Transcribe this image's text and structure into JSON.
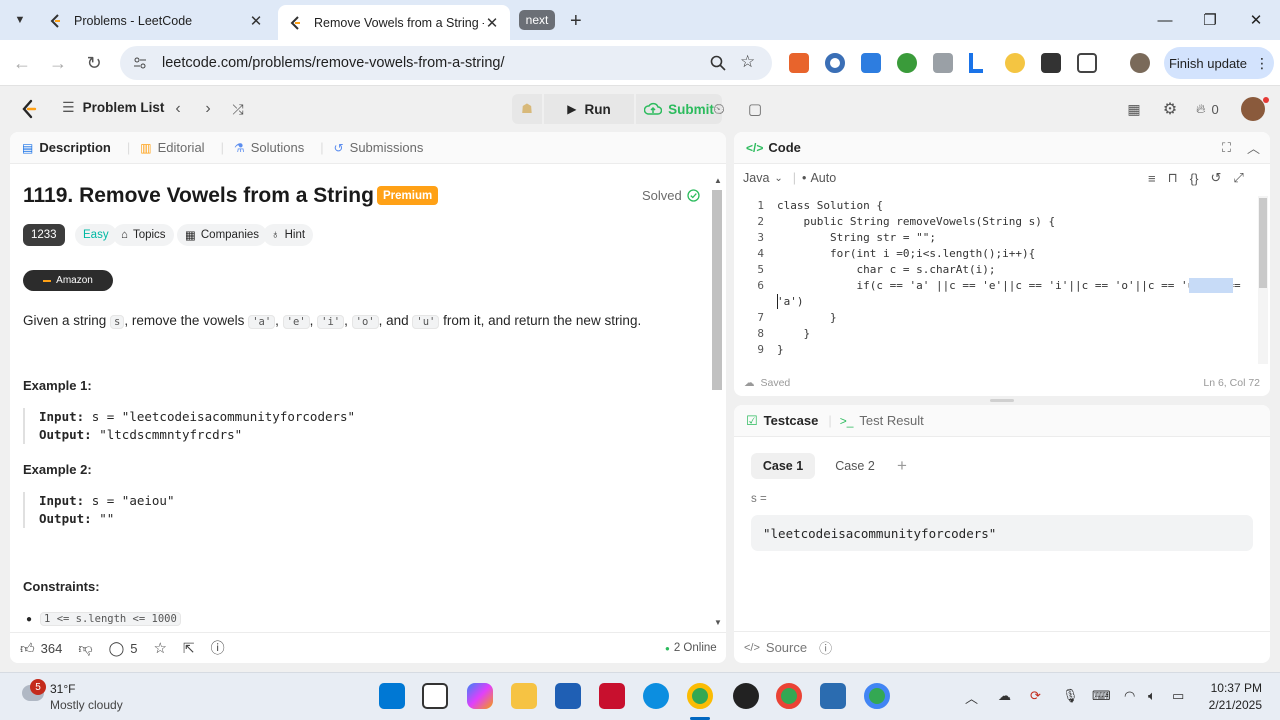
{
  "browser": {
    "tabs": [
      {
        "title": "Problems - LeetCode",
        "active": false
      },
      {
        "title": "Remove Vowels from a String -",
        "active": true
      }
    ],
    "group_chip": "next",
    "url": "leetcode.com/problems/remove-vowels-from-a-string/",
    "finish_update": "Finish update"
  },
  "app": {
    "nav": {
      "problem_list": "Problem List"
    },
    "run_label": "Run",
    "submit_label": "Submit",
    "streak_count": "0",
    "colors": {
      "accent": "#ffa116",
      "success": "#2cbb5d",
      "easy": "#00b8a3"
    }
  },
  "description": {
    "tabs": [
      "Description",
      "Editorial",
      "Solutions",
      "Submissions"
    ],
    "title": "1119. Remove Vowels from a String",
    "premium": "Premium",
    "solved": "Solved",
    "tags": {
      "number": "1233",
      "difficulty": "Easy",
      "topics": "Topics",
      "companies": "Companies",
      "hint": "Hint"
    },
    "company": "Amazon",
    "statement": {
      "p1": "Given a string ",
      "s": "s",
      "p2": ", remove the vowels ",
      "vowels": [
        "'a'",
        "'e'",
        "'i'",
        "'o'",
        "'u'"
      ],
      "sep": ", ",
      "and": ", and ",
      "p3": " from it, and return the new string."
    },
    "examples": [
      {
        "title": "Example 1:",
        "input_label": "Input:",
        "input": "s = \"leetcodeisacommunityforcoders\"",
        "output_label": "Output:",
        "output": "\"ltcdscmmntyfrcdrs\""
      },
      {
        "title": "Example 2:",
        "input_label": "Input:",
        "input": "s = \"aeiou\"",
        "output_label": "Output:",
        "output": "\"\""
      }
    ],
    "constraints_title": "Constraints:",
    "constraint_1": "1 <= s.length <= 1000",
    "footer": {
      "likes": "364",
      "comments": "5",
      "online": "2 Online"
    }
  },
  "code": {
    "title": "Code",
    "language": "Java",
    "mode": "Auto",
    "lines": [
      "class Solution {",
      "    public String removeVowels(String s) {",
      "        String str = \"\";",
      "        for(int i =0;i<s.length();i++){",
      "            char c = s.charAt(i);",
      "            if(c == 'a' ||c == 'e'||c == 'i'||c == 'o'||c == 'u'||c ==",
      "'a')",
      "        }",
      "    }",
      "}"
    ],
    "line_numbers": [
      "1",
      "2",
      "3",
      "4",
      "5",
      "6",
      "7",
      "8",
      "9"
    ],
    "saved": "Saved",
    "cursor": "Ln 6, Col 72"
  },
  "testcase": {
    "tabs": [
      "Testcase",
      "Test Result"
    ],
    "cases": [
      "Case 1",
      "Case 2"
    ],
    "var_label": "s =",
    "value": "\"leetcodeisacommunityforcoders\"",
    "source": "Source"
  },
  "taskbar": {
    "weather_badge": "5",
    "temperature": "31°F",
    "weather": "Mostly cloudy",
    "time": "10:37 PM",
    "date": "2/21/2025"
  }
}
